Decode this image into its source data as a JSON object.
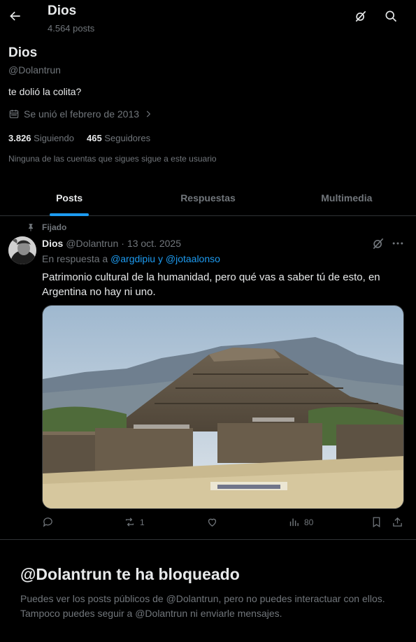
{
  "header": {
    "title": "Dios",
    "posts_count": "4.564 posts"
  },
  "profile": {
    "name": "Dios",
    "handle": "@Dolantrun",
    "bio": "te dolió la colita?",
    "joined": "Se unió el febrero de 2013",
    "following_count": "3.826",
    "following_label": "Siguiendo",
    "followers_count": "465",
    "followers_label": "Seguidores",
    "no_followers_known": "Ninguna de las cuentas que sigues sigue a este usuario"
  },
  "tabs": [
    {
      "label": "Posts",
      "active": true
    },
    {
      "label": "Respuestas",
      "active": false
    },
    {
      "label": "Multimedia",
      "active": false
    }
  ],
  "post": {
    "pinned_label": "Fijado",
    "author_name": "Dios",
    "author_handle": "@Dolantrun",
    "separator": "·",
    "date": "13 oct. 2025",
    "reply_prefix": "En respuesta a",
    "reply_mentions": "@argdipiu y @jotaalonso",
    "text": "Patrimonio cultural de la humanidad, pero qué vas a saber tú de esto, en Argentina no hay ni uno.",
    "image_subject": "pyramid-of-the-sun-teotihuacan",
    "retweets": "1",
    "views": "80"
  },
  "blocked": {
    "title": "@Dolantrun te ha bloqueado",
    "text": "Puedes ver los posts públicos de @Dolantrun, pero no puedes interactuar con ellos. Tampoco puedes seguir a @Dolantrun ni enviarle mensajes."
  },
  "colors": {
    "background": "#000000",
    "text_primary": "#e7e9ea",
    "text_secondary": "#71767b",
    "accent": "#1d9bf0",
    "border": "#2f3336"
  }
}
